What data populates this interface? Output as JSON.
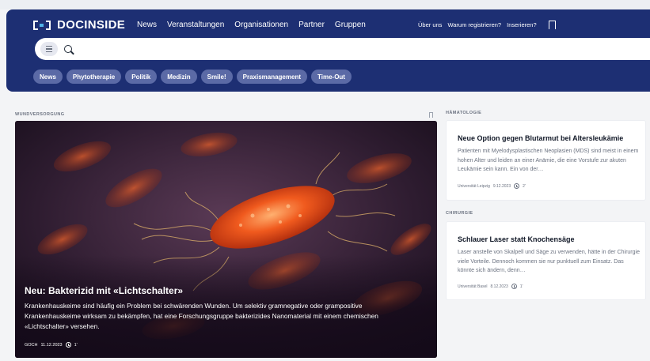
{
  "brand": {
    "name": "DOCINSIDE",
    "accent": "#1d2f73",
    "chip_color": "#5b6aa6"
  },
  "main_nav": [
    "News",
    "Veranstaltungen",
    "Organisationen",
    "Partner",
    "Gruppen"
  ],
  "util_nav": [
    "Über uns",
    "Warum registrieren?",
    "Inserieren?"
  ],
  "search": {
    "value": "",
    "placeholder": ""
  },
  "chips": [
    "News",
    "Phytotherapie",
    "Politik",
    "Medizin",
    "Smile!",
    "Praxismanagement",
    "Time-Out"
  ],
  "hero": {
    "section": "WUNDVERSORGUNG",
    "title": "Neu: Bakterizid mit «Lichtschalter»",
    "text": "Krankenhauskeime sind häufig ein Problem bei schwärenden Wunden. Um selektiv gramnegative oder grampositive Krankenhauskeime wirksam zu bekämpfen, hat eine Forschungsgruppe bakterizides Nanomaterial mit einem chemischen «Lichtschalter» versehen.",
    "source": "GOCH",
    "date": "11.12.2023",
    "read_time": "1'"
  },
  "side_articles": [
    {
      "section": "HÄMATOLOGIE",
      "title": "Neue Option gegen Blutarmut bei Altersleukämie",
      "text": "Patienten mit Myelodysplastischen Neoplasien (MDS) sind meist in einem hohen Alter und leiden an einer Anämie, die eine Vorstufe zur akuten Leukämie sein kann. Ein von der…",
      "source": "Universität Leipzig",
      "date": "9.12.2023",
      "read_time": "2'"
    },
    {
      "section": "CHIRURGIE",
      "title": "Schlauer Laser statt Knochensäge",
      "text": "Laser anstelle von Skalpell und Säge zu verwenden, hätte in der Chirurgie viele Vorteile. Dennoch kommen sie nur punktuell zum Einsatz. Das könnte sich ändern, denn…",
      "source": "Universität Basel",
      "date": "8.12.2023",
      "read_time": "1'"
    }
  ]
}
